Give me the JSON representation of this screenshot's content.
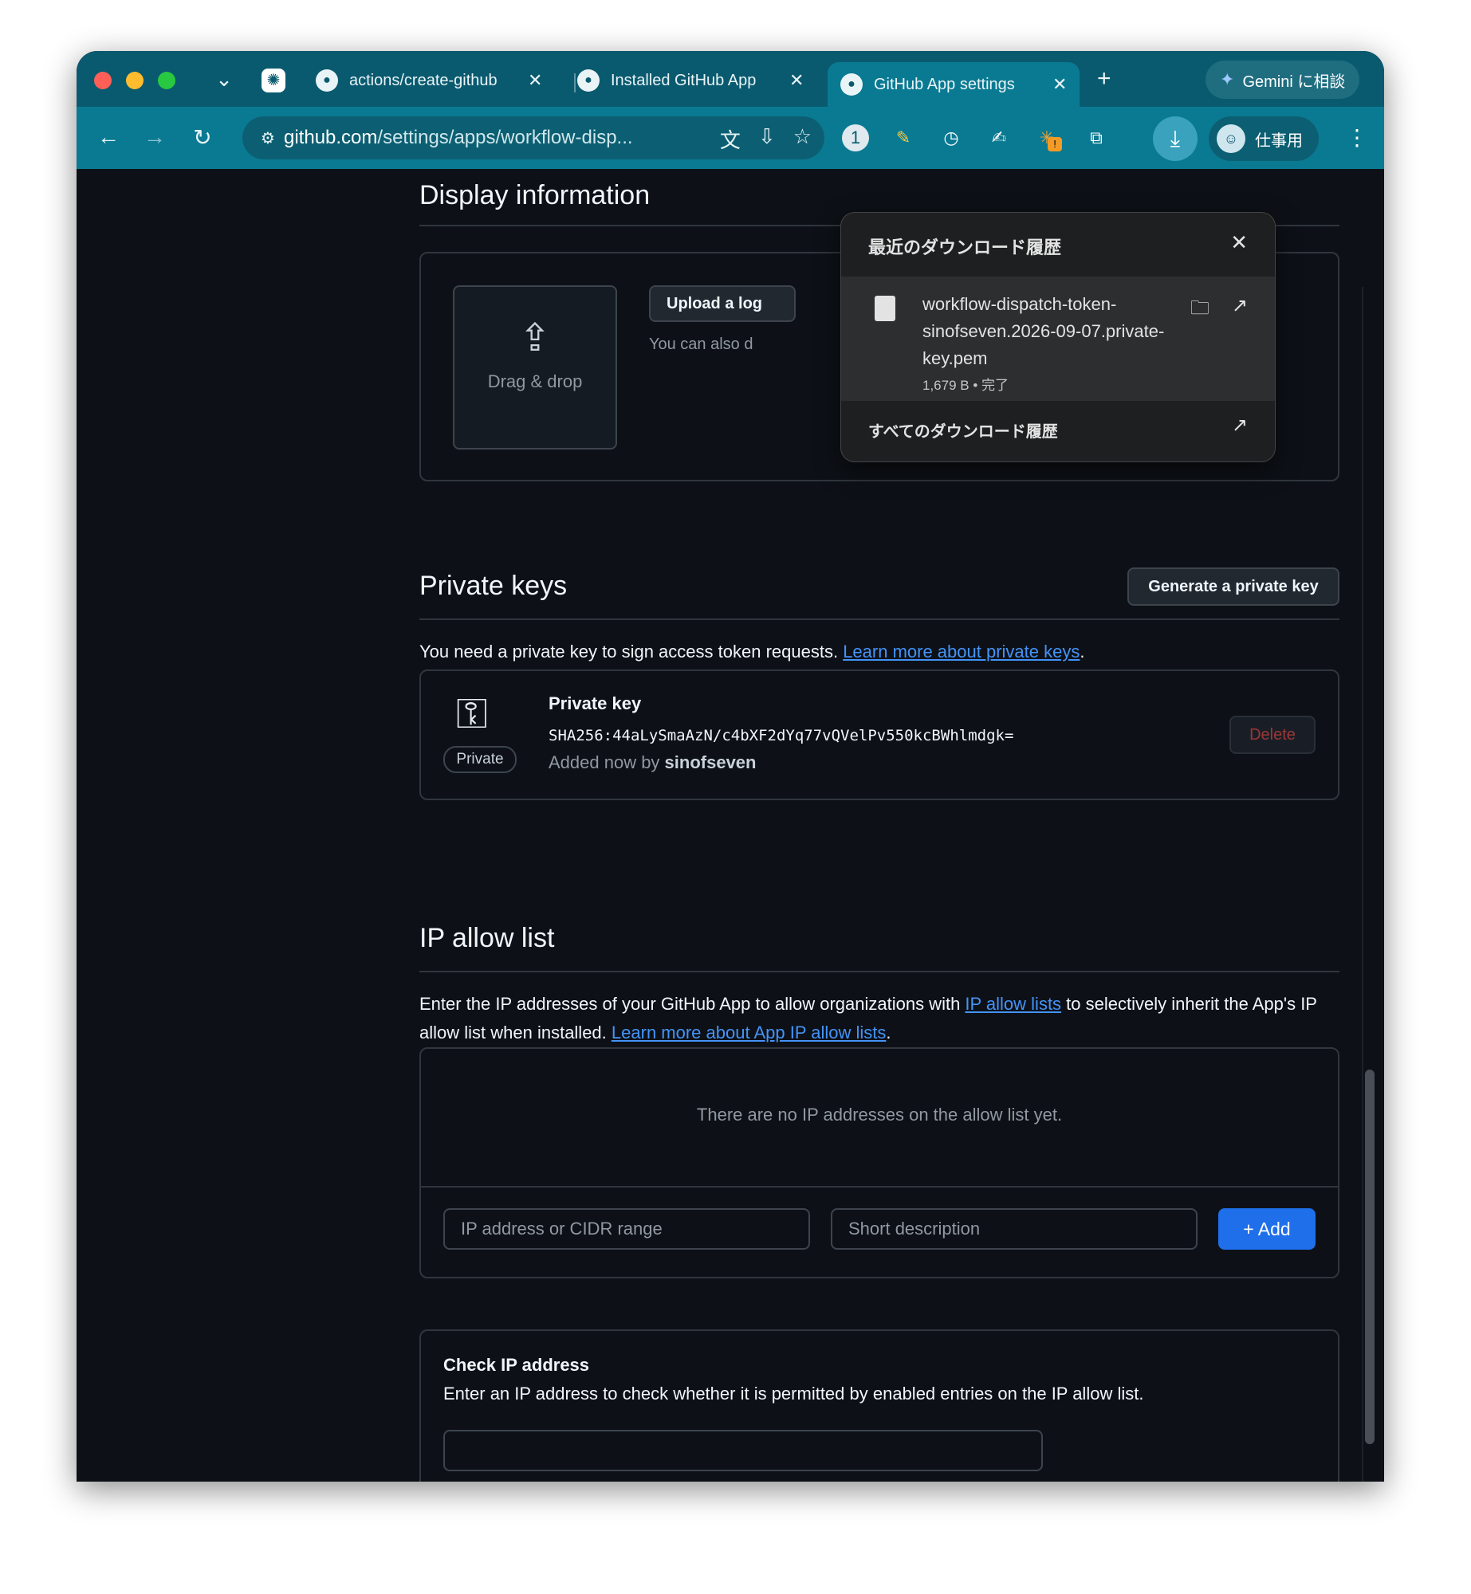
{
  "browser": {
    "tabs": [
      {
        "label": "actions/create-github",
        "close": "✕"
      },
      {
        "label": "Installed GitHub App",
        "close": "✕"
      },
      {
        "label": "GitHub App settings",
        "close": "✕"
      }
    ],
    "new_tab": "+",
    "gemini_label": "Gemini に相談",
    "url_host": "github.com",
    "url_path": "/settings/apps/workflow-disp...",
    "profile_label": "仕事用",
    "extension_badge": "!"
  },
  "downloads": {
    "title": "最近のダウンロード履歴",
    "file_name": "workflow-dispatch-token-sinofseven.2026-09-07.private-key.pem",
    "file_meta": "1,679 B • 完了",
    "all_label": "すべてのダウンロード履歴"
  },
  "display_info": {
    "heading": "Display information",
    "drag_drop": "Drag & drop",
    "upload_button": "Upload a log",
    "hint": "You can also d"
  },
  "private_keys": {
    "heading": "Private keys",
    "generate_button": "Generate a private key",
    "description": "You need a private key to sign access token requests. ",
    "learn_more": "Learn more about private keys",
    "period": ".",
    "key_title": "Private key",
    "fingerprint": "SHA256:44aLySmaAzN/c4bXF2dYq77vQVelPv550kcBWhlmdgk=",
    "added_prefix": "Added now by ",
    "added_user": "sinofseven",
    "badge": "Private",
    "delete_button": "Delete"
  },
  "ip_allow": {
    "heading": "IP allow list",
    "desc_1": "Enter the IP addresses of your GitHub App to allow organizations with ",
    "desc_link_1": "IP allow lists",
    "desc_2": " to selectively inherit the App's IP allow list when installed. ",
    "desc_link_2": "Learn more about App IP allow lists",
    "desc_end": ".",
    "empty_text": "There are no IP addresses on the allow list yet.",
    "ip_placeholder": "IP address or CIDR range",
    "desc_placeholder": "Short description",
    "add_button": "+ Add"
  },
  "check_ip": {
    "title": "Check IP address",
    "description": "Enter an IP address to check whether it is permitted by enabled entries on the IP allow list."
  },
  "colors": {
    "accent_blue": "#4493f8",
    "add_button": "#1f6feb",
    "delete_text": "#f85149",
    "chrome_teal": "#0a7a92"
  }
}
